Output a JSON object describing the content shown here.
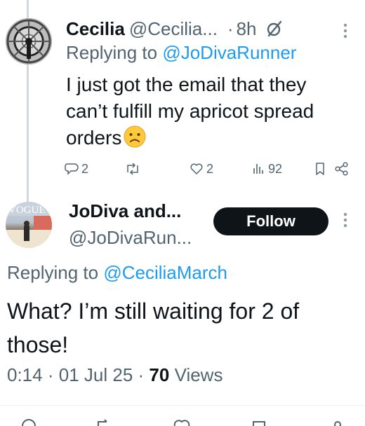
{
  "tweet1": {
    "display_name": "Cecilia",
    "handle": "@Cecilia...",
    "separator": "·",
    "time": "8h",
    "reply_prefix": "Replying to",
    "reply_to": "@JoDivaRunner",
    "text": "I just got the email that they can’t fulfill my apricot spread orders",
    "emoji": "confused-face",
    "actions": {
      "replies": "2",
      "retweets": "",
      "likes": "2",
      "views": "92"
    }
  },
  "tweet2": {
    "display_name": "JoDiva and...",
    "handle": "@JoDivaRun...",
    "follow_label": "Follow",
    "reply_prefix": "Replying to",
    "reply_to": "@CeciliaMarch",
    "text": "What? I’m still waiting for 2 of those!",
    "time": "0:14",
    "date": "01 Jul 25",
    "dot1": "·",
    "dot2": "·",
    "views_count": "70",
    "views_label": "Views",
    "avatar_text": "VOGUE"
  },
  "colors": {
    "text_primary": "#0f1419",
    "text_secondary": "#536471",
    "link": "#1d9bf0",
    "button_bg": "#0f1419",
    "thread_line": "#cfd9de"
  }
}
